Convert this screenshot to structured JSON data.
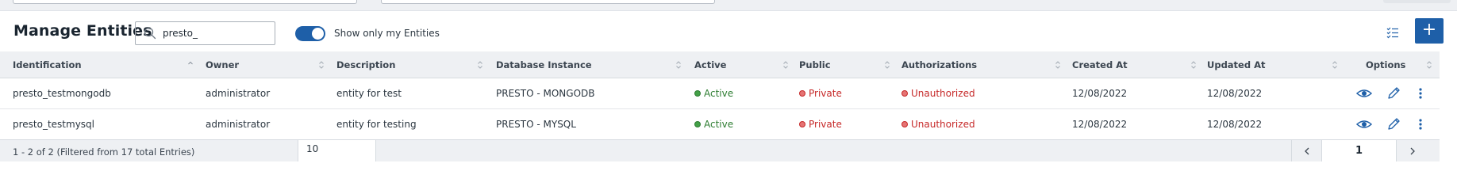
{
  "header": {
    "title": "Manage Entities",
    "search_value": "presto_",
    "toggle_label": "Show only my Entities",
    "toggle_on": true,
    "add_label": "+"
  },
  "table": {
    "columns": [
      "Identification",
      "Owner",
      "Description",
      "Database Instance",
      "Active",
      "Public",
      "Authorizations",
      "Created At",
      "Updated At",
      "Options"
    ],
    "rows": [
      {
        "identification": "presto_testmongodb",
        "owner": "administrator",
        "description": "entity for test",
        "database_instance": "PRESTO - MONGODB",
        "active": "Active",
        "public": "Private",
        "authorizations": "Unauthorized",
        "created_at": "12/08/2022",
        "updated_at": "12/08/2022"
      },
      {
        "identification": "presto_testmysql",
        "owner": "administrator",
        "description": "entity for testing",
        "database_instance": "PRESTO - MYSQL",
        "active": "Active",
        "public": "Private",
        "authorizations": "Unauthorized",
        "created_at": "12/08/2022",
        "updated_at": "12/08/2022"
      }
    ]
  },
  "footer": {
    "count_text": "1 - 2 of 2 (Filtered from 17 total Entries)",
    "page_size": "10",
    "current_page": "1"
  },
  "colors": {
    "primary": "#1e5fa8",
    "active_green": "#2e7d32",
    "private_red": "#c62828",
    "header_bg": "#eef0f3"
  },
  "icons": [
    "search-icon",
    "list-view-icon",
    "add-icon",
    "sort-icon",
    "view-eye-icon",
    "edit-pencil-icon",
    "more-vertical-icon",
    "chevron-left-icon",
    "chevron-right-icon"
  ]
}
